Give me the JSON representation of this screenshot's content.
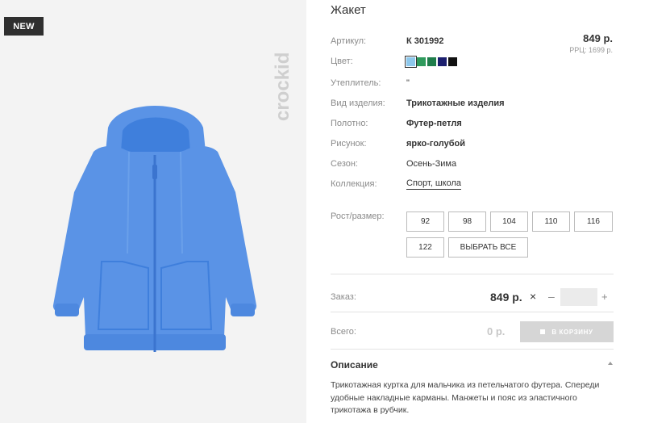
{
  "badge": {
    "label": "NEW"
  },
  "brand": {
    "logo_text": "crockid"
  },
  "product": {
    "title": "Жакет",
    "price": "849 р.",
    "rrp": "РРЦ: 1699 р."
  },
  "attributes": [
    {
      "label": "Артикул:",
      "value": "К 301992"
    },
    {
      "label": "Цвет:",
      "value": ""
    },
    {
      "label": "Утеплитель:",
      "value": "\""
    },
    {
      "label": "Вид изделия:",
      "value": "Трикотажные изделия"
    },
    {
      "label": "Полотно:",
      "value": "Футер-петля"
    },
    {
      "label": "Рисунок:",
      "value": "ярко-голубой"
    },
    {
      "label": "Сезон:",
      "value": "Осень-Зима"
    },
    {
      "label": "Коллекция:",
      "value": "Спорт, школа"
    }
  ],
  "colors": [
    {
      "name": "light-blue",
      "hex": "#8ec8ec",
      "selected": true
    },
    {
      "name": "green",
      "hex": "#2f9a5c",
      "selected": false
    },
    {
      "name": "dark-green",
      "hex": "#1f7d4b",
      "selected": false
    },
    {
      "name": "navy",
      "hex": "#1c1f6e",
      "selected": false
    },
    {
      "name": "black",
      "hex": "#111111",
      "selected": false
    }
  ],
  "sizes": {
    "label": "Рост/размер:",
    "options": [
      "92",
      "98",
      "104",
      "110",
      "116",
      "122"
    ],
    "select_all": "ВЫБРАТЬ ВСЕ"
  },
  "order": {
    "label": "Заказ:",
    "price": "849 р.",
    "remove_icon": "×",
    "minus": "–",
    "quantity": "",
    "plus": "+"
  },
  "total": {
    "label": "Всего:",
    "value": "0 р.",
    "cart_button": "В КОРЗИНУ"
  },
  "description": {
    "title": "Описание",
    "text": "Трикотажная куртка для мальчика из петельчатого футера. Спереди удобные накладные карманы. Манжеты и пояс из эластичного трикотажа в рубчик."
  }
}
